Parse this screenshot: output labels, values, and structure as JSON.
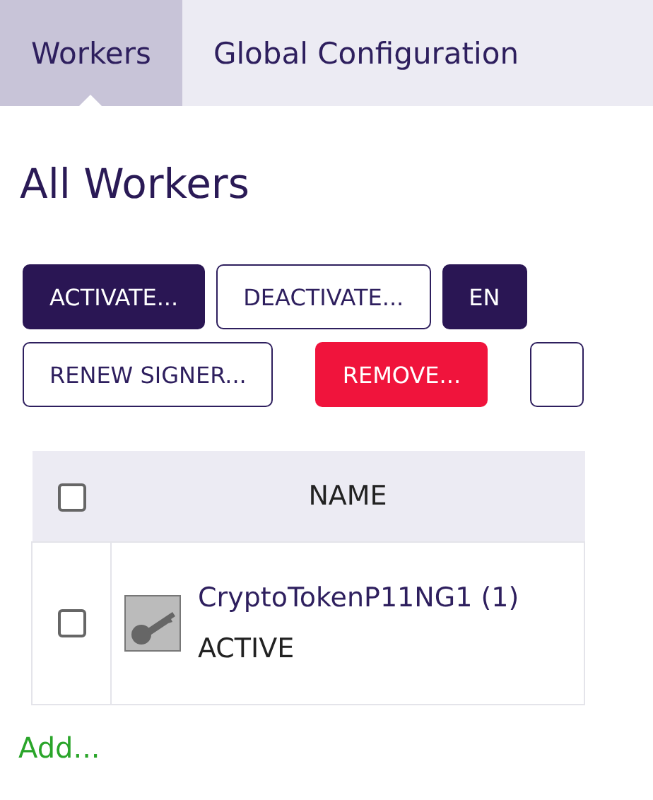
{
  "tabs": [
    {
      "label": "Workers",
      "selected": true
    },
    {
      "label": "Global Configuration",
      "selected": false
    }
  ],
  "heading": "All Workers",
  "button_rows": [
    [
      {
        "label": "ACTIVATE...",
        "kind": "primary"
      },
      {
        "label": "DEACTIVATE...",
        "kind": "outline"
      },
      {
        "label": "EN",
        "kind": "primary"
      }
    ],
    [
      {
        "label": "RENEW SIGNER...",
        "kind": "outline"
      },
      {
        "label": "REMOVE...",
        "kind": "danger"
      },
      {
        "kind": "outline"
      }
    ]
  ],
  "table": {
    "select_all": {
      "checked": false
    },
    "columns": [
      "NAME"
    ],
    "rows": [
      {
        "checked": false,
        "name": "CryptoTokenP11NG1 (1)",
        "status": "ACTIVE"
      }
    ]
  },
  "add_link": "Add..."
}
